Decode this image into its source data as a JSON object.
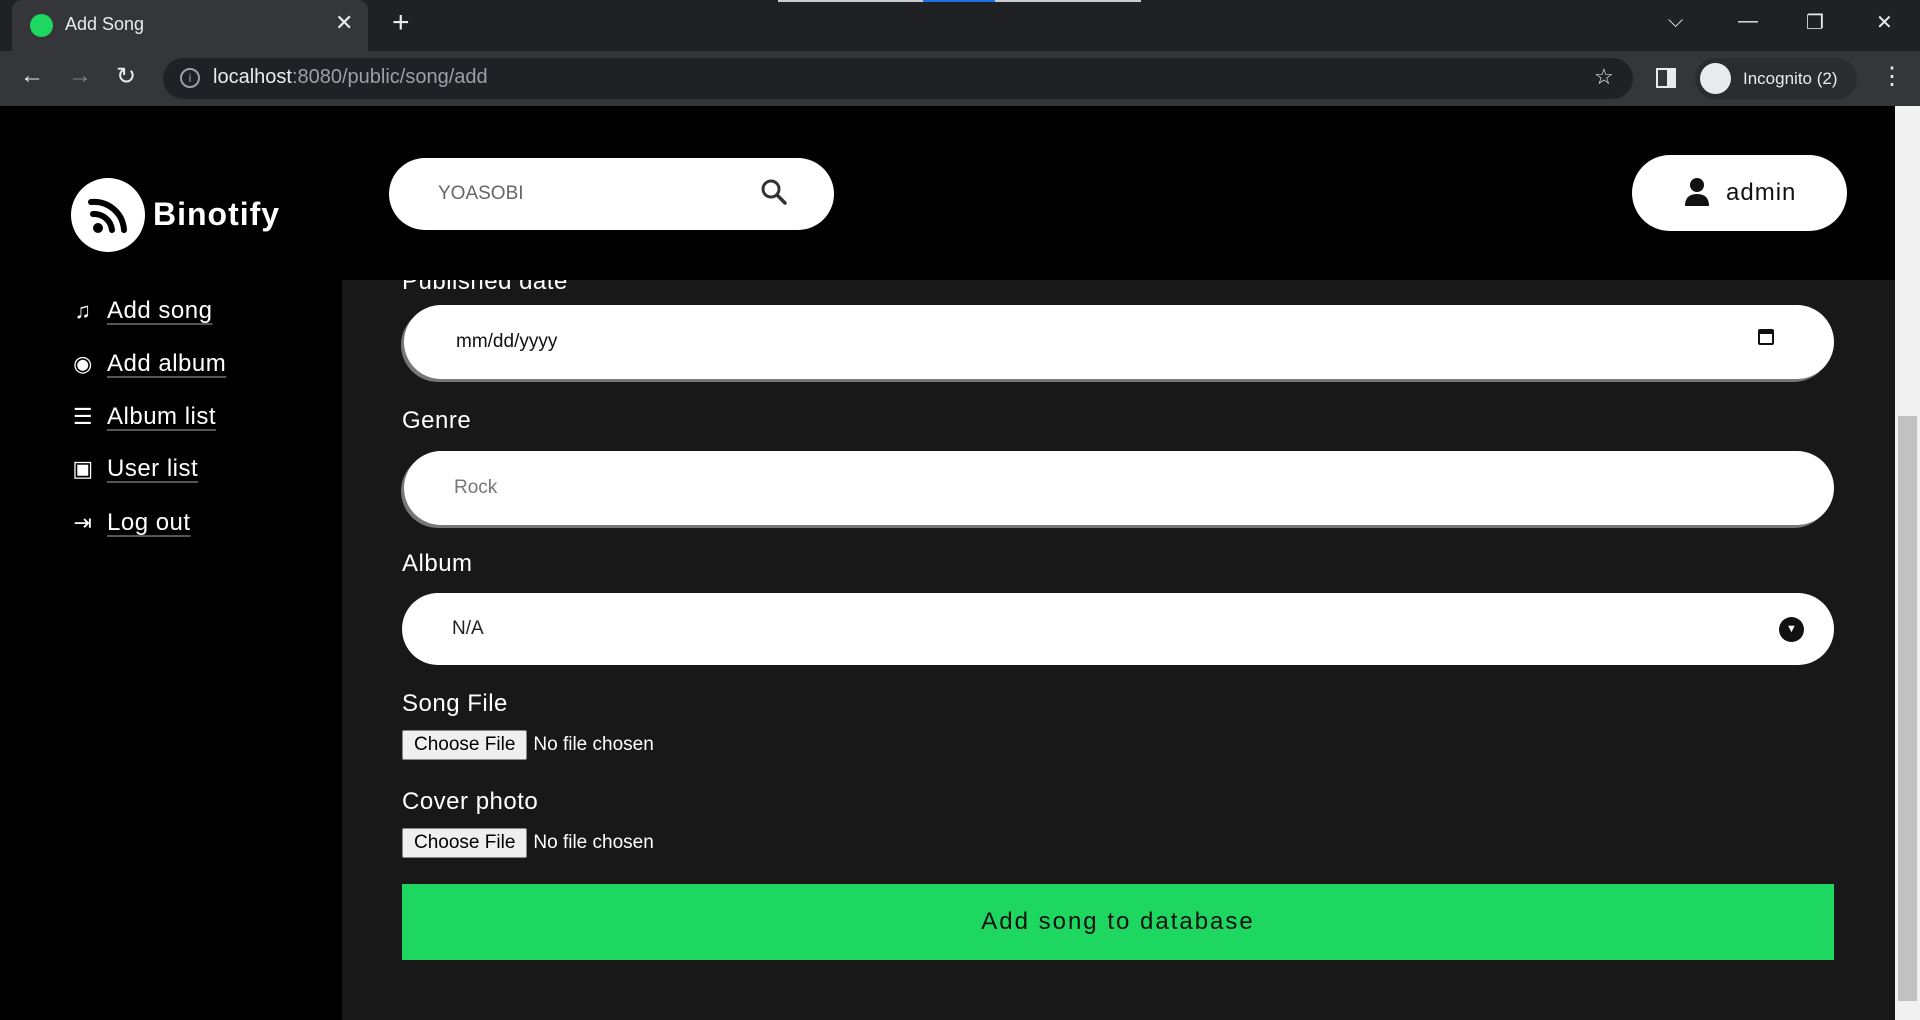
{
  "browser": {
    "tab_title": "Add Song",
    "url_host": "localhost",
    "url_path": ":8080/public/song/add",
    "profile": "Incognito (2)"
  },
  "sidebar": {
    "brand": "Binotify",
    "items": [
      {
        "label": "Add song",
        "icon": "music-note-icon"
      },
      {
        "label": "Add album",
        "icon": "disc-icon"
      },
      {
        "label": "Album list",
        "icon": "ordered-list-icon"
      },
      {
        "label": "User list",
        "icon": "contact-card-icon"
      },
      {
        "label": "Log out",
        "icon": "logout-icon"
      }
    ]
  },
  "header": {
    "search_placeholder": "YOASOBI",
    "user": "admin"
  },
  "form": {
    "published_label": "Published date",
    "published_placeholder": "mm/dd/yyyy",
    "genre_label": "Genre",
    "genre_placeholder": "Rock",
    "album_label": "Album",
    "album_value": "N/A",
    "song_file_label": "Song File",
    "cover_label": "Cover photo",
    "choose_file": "Choose File",
    "no_file": "No file chosen",
    "submit": "Add song to database"
  },
  "colors": {
    "accent": "#1ed760",
    "content_bg": "#181818"
  }
}
